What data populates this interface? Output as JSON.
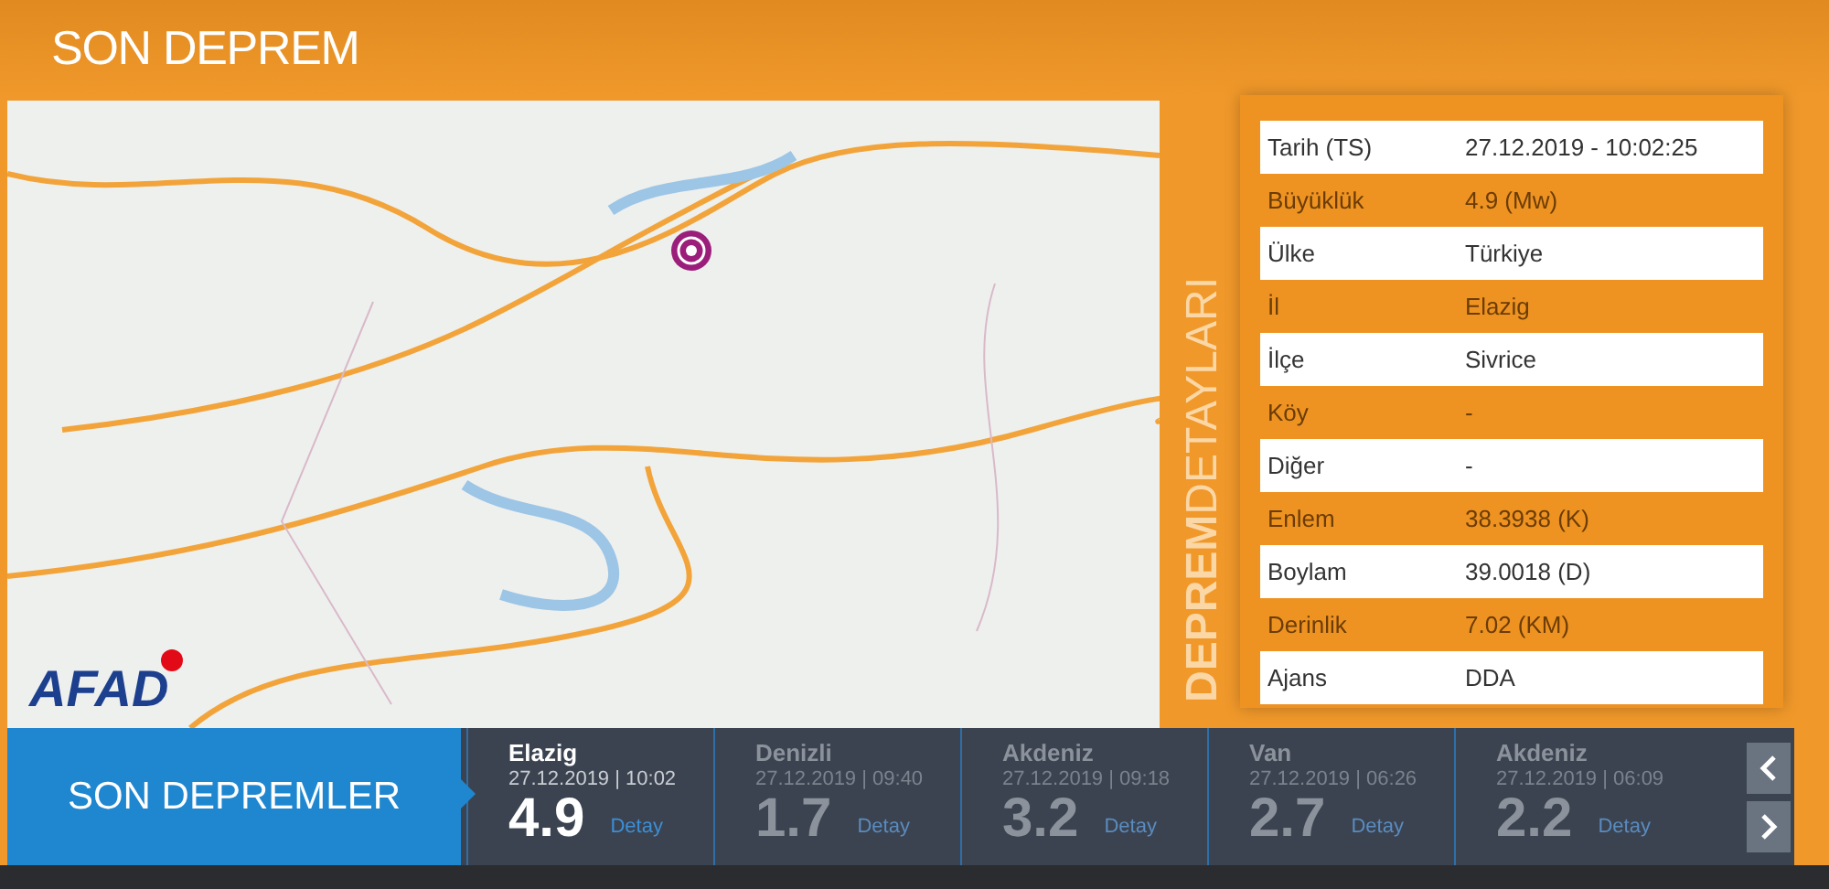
{
  "header": {
    "title": "SON DEPREM"
  },
  "map": {
    "logo": "AFAD"
  },
  "details": {
    "side_label": "**DEPREM**DETAYLARI",
    "rows": [
      {
        "label": "Tarih (TS)",
        "value": "27.12.2019 - 10:02:25"
      },
      {
        "label": "Büyüklük",
        "value": "4.9 (Mw)"
      },
      {
        "label": "Ülke",
        "value": "Türkiye"
      },
      {
        "label": "İl",
        "value": "Elazig"
      },
      {
        "label": "İlçe",
        "value": "Sivrice"
      },
      {
        "label": "Köy",
        "value": "-"
      },
      {
        "label": "Diğer",
        "value": "-"
      },
      {
        "label": "Enlem",
        "value": "38.3938 (K)"
      },
      {
        "label": "Boylam",
        "value": "39.0018 (D)"
      },
      {
        "label": "Derinlik",
        "value": "7.02 (KM)"
      },
      {
        "label": "Ajans",
        "value": "DDA"
      }
    ]
  },
  "recent": {
    "title": "SON DEPREMLER",
    "items": [
      {
        "place": "Elazig",
        "time": "27.12.2019 | 10:02",
        "magnitude": "4.9",
        "link": "Detay",
        "selected": true
      },
      {
        "place": "Denizli",
        "time": "27.12.2019 | 09:40",
        "magnitude": "1.7",
        "link": "Detay",
        "selected": false
      },
      {
        "place": "Akdeniz",
        "time": "27.12.2019 | 09:18",
        "magnitude": "3.2",
        "link": "Detay",
        "selected": false
      },
      {
        "place": "Van",
        "time": "27.12.2019 | 06:26",
        "magnitude": "2.7",
        "link": "Detay",
        "selected": false
      },
      {
        "place": "Akdeniz",
        "time": "27.12.2019 | 06:09",
        "magnitude": "2.2",
        "link": "Detay",
        "selected": false
      }
    ]
  }
}
